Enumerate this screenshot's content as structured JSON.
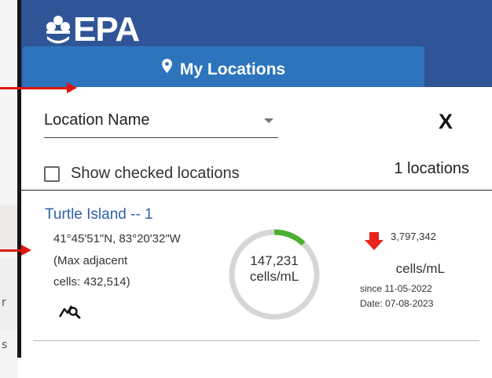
{
  "header": {
    "logo_text": "EPA",
    "logo_icon": "epa-flower-icon",
    "brand_color": "#2f5596",
    "tab": {
      "label": "My Locations",
      "icon": "map-pin-icon",
      "color": "#2d74bd"
    }
  },
  "controls": {
    "sort_select": {
      "value": "Location Name",
      "icon": "dropdown-caret-icon"
    },
    "close_label": "X",
    "show_checked_label": "Show checked locations",
    "show_checked": false,
    "location_count": "1 locations"
  },
  "locations": [
    {
      "name": "Turtle Island -- 1",
      "coords": "41°45'51\"N, 83°20'32\"W",
      "max_line1": "(Max adjacent",
      "max_line2": "cells: 432,514)",
      "trend_icon": "trend-search-icon",
      "gauge": {
        "value": "147,231",
        "unit": "cells/mL",
        "fill_fraction": 0.12,
        "fill_color": "#4caf2f",
        "track_color": "#d6d6d6"
      },
      "change": {
        "direction": "down",
        "icon": "down-arrow-icon",
        "color": "#e8241c",
        "value": "3,797,342",
        "unit": "cells/mL",
        "since": "since 11-05-2022",
        "date": "Date: 07-08-2023"
      }
    }
  ],
  "annotations": {
    "arrow_color": "#e1170f"
  }
}
